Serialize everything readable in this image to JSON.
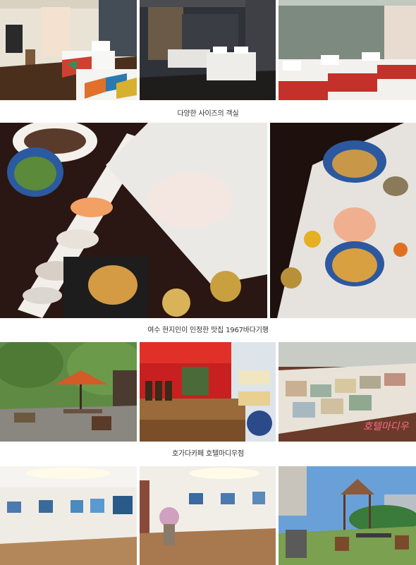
{
  "captions": {
    "rooms": "다양한 사이즈의 객실",
    "restaurant": "여수 현지인이 인정한 맛집  1967바다기행",
    "cafe_shop": "호가다카페  호텔마디우점"
  },
  "photos": {
    "room_twin": "room-twin-photo",
    "room_dark": "room-dark-photo",
    "room_red": "room-red-photo",
    "sushi_platter": "sushi-platter-photo",
    "boat_platter": "boat-platter-photo",
    "garden_cafe": "garden-cafe-photo",
    "shop_shelf": "shop-shelf-photo",
    "book_display": "book-display-photo",
    "gallery_left": "gallery-left-photo",
    "gallery_right": "gallery-right-photo",
    "rooftop_garden": "rooftop-garden-photo"
  },
  "sign_text": "호텔마디우"
}
